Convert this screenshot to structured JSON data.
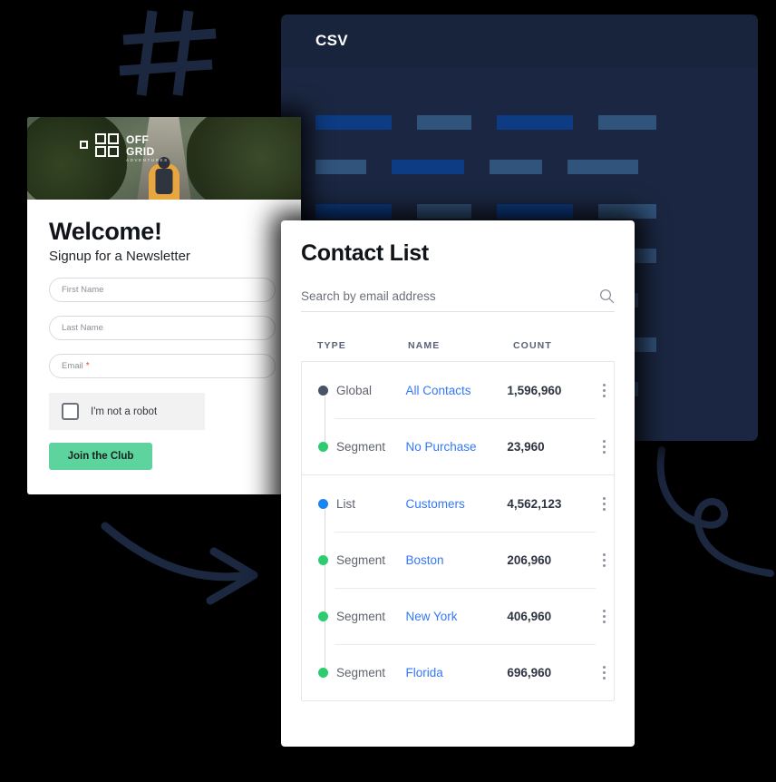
{
  "background": {
    "color": "#000000",
    "decorations": [
      {
        "name": "hash-icon",
        "color": "#1c2740"
      },
      {
        "name": "curved-arrow-icon",
        "color": "#1c2740"
      },
      {
        "name": "trend-loop-icon",
        "color": "#1c2740"
      }
    ]
  },
  "csv_panel": {
    "title": "CSV",
    "panel_color": "#1b2742",
    "header_color": "#18233c",
    "bar_bright_color": "#0d3c84",
    "bar_muted_color": "#31547c",
    "rows": [
      [
        {
          "w": 84,
          "tone": "bright"
        },
        {
          "w": 60,
          "tone": "muted"
        },
        {
          "w": 84,
          "tone": "bright"
        },
        {
          "w": 64,
          "tone": "muted"
        }
      ],
      [
        {
          "w": 56,
          "tone": "muted"
        },
        {
          "w": 80,
          "tone": "bright"
        },
        {
          "w": 58,
          "tone": "muted"
        },
        {
          "w": 78,
          "tone": "muted"
        }
      ],
      [
        {
          "w": 84,
          "tone": "bright"
        },
        {
          "w": 60,
          "tone": "muted"
        },
        {
          "w": 84,
          "tone": "bright"
        },
        {
          "w": 64,
          "tone": "muted"
        }
      ],
      [
        {
          "w": 84,
          "tone": "bright"
        },
        {
          "w": 60,
          "tone": "muted"
        },
        {
          "w": 84,
          "tone": "bright"
        },
        {
          "w": 64,
          "tone": "muted"
        }
      ],
      [
        {
          "w": 56,
          "tone": "muted"
        },
        {
          "w": 80,
          "tone": "bright"
        },
        {
          "w": 58,
          "tone": "muted"
        },
        {
          "w": 78,
          "tone": "muted"
        }
      ],
      [
        {
          "w": 84,
          "tone": "bright"
        },
        {
          "w": 60,
          "tone": "muted"
        },
        {
          "w": 84,
          "tone": "bright"
        },
        {
          "w": 64,
          "tone": "muted"
        }
      ],
      [
        {
          "w": 56,
          "tone": "muted"
        },
        {
          "w": 80,
          "tone": "bright"
        },
        {
          "w": 58,
          "tone": "muted"
        },
        {
          "w": 78,
          "tone": "muted"
        }
      ]
    ]
  },
  "newsletter": {
    "logo": {
      "line1": "OFF",
      "line2": "GRID",
      "subtitle": "ADVENTURES"
    },
    "title": "Welcome!",
    "subtitle": "Signup for a Newsletter",
    "fields": [
      {
        "name": "first-name-field",
        "placeholder": "First Name",
        "value": "",
        "required": false
      },
      {
        "name": "last-name-field",
        "placeholder": "Last Name",
        "value": "",
        "required": false
      },
      {
        "name": "email-field",
        "placeholder": "Email",
        "value": "",
        "required": true
      }
    ],
    "required_marker": "*",
    "captcha_label": "I'm not a robot",
    "submit_label": "Join the Club",
    "submit_color": "#5dd39e"
  },
  "contact_list": {
    "title": "Contact List",
    "search": {
      "placeholder": "Search by email address",
      "value": ""
    },
    "columns": [
      "TYPE",
      "NAME",
      "COUNT"
    ],
    "dot_colors": {
      "global": "#4a5268",
      "segment": "#2ecc71",
      "list": "#1a86f0"
    },
    "groups": [
      {
        "rows": [
          {
            "type": "Global",
            "dot": "global",
            "name": "All Contacts",
            "count": "1,596,960",
            "child": false
          },
          {
            "type": "Segment",
            "dot": "segment",
            "name": "No Purchase",
            "count": "23,960",
            "child": true
          }
        ]
      },
      {
        "rows": [
          {
            "type": "List",
            "dot": "list",
            "name": "Customers",
            "count": "4,562,123",
            "child": false
          },
          {
            "type": "Segment",
            "dot": "segment",
            "name": "Boston",
            "count": "206,960",
            "child": true
          },
          {
            "type": "Segment",
            "dot": "segment",
            "name": "New York",
            "count": "406,960",
            "child": true
          },
          {
            "type": "Segment",
            "dot": "segment",
            "name": "Florida",
            "count": "696,960",
            "child": true
          }
        ]
      }
    ]
  }
}
